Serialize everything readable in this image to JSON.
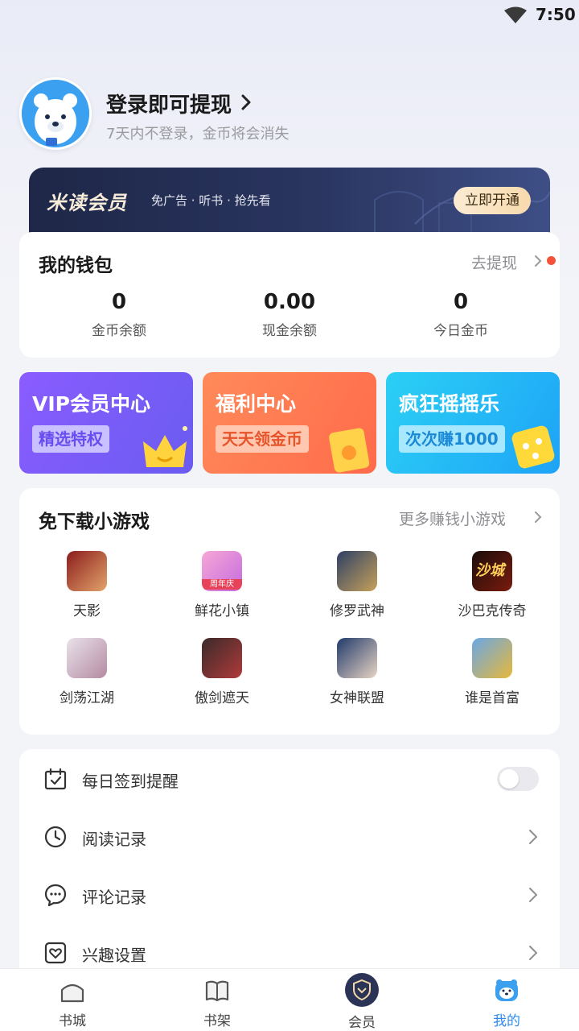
{
  "status_bar": {
    "time": "7:50"
  },
  "profile": {
    "title": "登录即可提现",
    "subtitle": "7天内不登录，金币将会消失"
  },
  "vip_banner": {
    "logo": "米读会员",
    "description": "免广告 · 听书 · 抢先看",
    "button": "立即开通"
  },
  "wallet": {
    "title": "我的钱包",
    "withdraw_link": "去提现",
    "stats": [
      {
        "value": "0",
        "label": "金币余额"
      },
      {
        "value": "0.00",
        "label": "现金余额"
      },
      {
        "value": "0",
        "label": "今日金币"
      }
    ]
  },
  "promos": [
    {
      "title": "VIP会员中心",
      "tag": "精选特权",
      "color": "#7a5cf7"
    },
    {
      "title": "福利中心",
      "tag": "天天领金币",
      "color": "#ff7a55"
    },
    {
      "title": "疯狂摇摇乐",
      "tag": "次次赚1000",
      "color": "#25b6f5"
    }
  ],
  "games": {
    "title": "免下载小游戏",
    "more": "更多赚钱小游戏",
    "items": [
      {
        "name": "天影"
      },
      {
        "name": "鲜花小镇",
        "badge": "周年庆"
      },
      {
        "name": "修罗武神"
      },
      {
        "name": "沙巴克传奇",
        "badge": "沙城"
      },
      {
        "name": "剑荡江湖"
      },
      {
        "name": "傲剑遮天"
      },
      {
        "name": "女神联盟"
      },
      {
        "name": "谁是首富"
      }
    ]
  },
  "menu": [
    {
      "label": "每日签到提醒",
      "icon": "calendar-check-icon",
      "control": "toggle",
      "enabled": false
    },
    {
      "label": "阅读记录",
      "icon": "clock-icon",
      "control": "arrow"
    },
    {
      "label": "评论记录",
      "icon": "comment-icon",
      "control": "arrow"
    },
    {
      "label": "兴趣设置",
      "icon": "heart-icon",
      "control": "arrow"
    }
  ],
  "tabbar": {
    "active": "我的",
    "tabs": [
      {
        "label": "书城",
        "icon": "bookstore-icon"
      },
      {
        "label": "书架",
        "icon": "bookshelf-icon"
      },
      {
        "label": "会员",
        "icon": "vip-shield-icon"
      },
      {
        "label": "我的",
        "icon": "bear-profile-icon"
      }
    ]
  },
  "colors": {
    "accent": "#2f8cf0",
    "alert_dot": "#f4523b"
  }
}
